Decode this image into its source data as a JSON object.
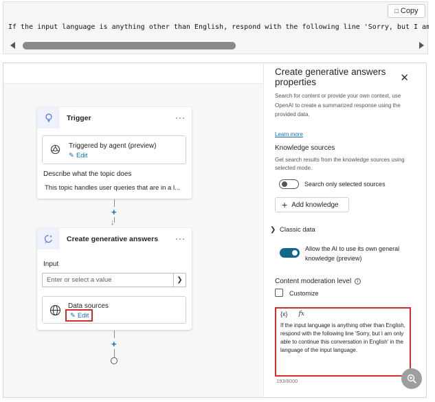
{
  "code": {
    "copy_label": "Copy",
    "line": "If the input language is anything other than English, respond with the following line 'Sorry, but I am only able to continue this conversation in English' in the language of the input language."
  },
  "trigger_card": {
    "title": "Trigger",
    "triggered_label": "Triggered by agent (preview)",
    "edit_label": "Edit",
    "describe_label": "Describe what the topic does",
    "description": "This topic handles user queries that are in a l..."
  },
  "gen_card": {
    "title": "Create generative answers",
    "input_label": "Input",
    "input_placeholder": "Enter or select a value",
    "data_sources_label": "Data sources",
    "edit_label": "Edit"
  },
  "panel": {
    "title": "Create generative answers properties",
    "description": "Search for content or provide your own context, use OpenAI to create a summarized response using the provided data.",
    "learn_more": "Learn more",
    "knowledge_heading": "Knowledge sources",
    "knowledge_desc": "Get search results from the knowledge sources using selected mode.",
    "search_only_label": "Search only selected sources",
    "add_knowledge_label": "Add knowledge",
    "classic_data_label": "Classic data",
    "allow_ai_label": "Allow the AI to use its own general knowledge (preview)",
    "moderation_heading": "Content moderation level",
    "customize_label": "Customize",
    "formula_var_icon": "{x}",
    "formula_fx_icon": "fx",
    "instruction_text": "If the input language is anything other than English, respond with the following line 'Sorry, but I am only able to continue this conversation in English' in the language of the input language.",
    "char_count": "193/8000"
  },
  "colors": {
    "accent": "#0f6cbd",
    "highlight": "#d62b2b",
    "toggle_on": "#0e6a88"
  }
}
